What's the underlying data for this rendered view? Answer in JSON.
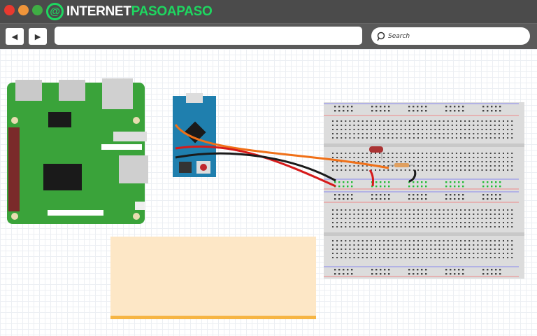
{
  "window": {
    "controls": [
      {
        "name": "close",
        "color": "#e8392f"
      },
      {
        "name": "minimize",
        "color": "#f0953a"
      },
      {
        "name": "maximize",
        "color": "#3fae44"
      }
    ]
  },
  "brand": {
    "part1": "INTERNET",
    "part2": "PASOAPASO",
    "icon": "at-sign-icon",
    "color1": "#ffffff",
    "color2": "#1ed760"
  },
  "toolbar": {
    "back": "◀",
    "forward": "▶",
    "url": "",
    "search_placeholder": "Search"
  },
  "diagram": {
    "board1": "raspberry-pi",
    "board2": "arduino-micro",
    "breadboard": "breadboard",
    "components": [
      "photoresistor",
      "resistor"
    ],
    "wire_colors": {
      "signal": "#f07018",
      "power": "#d61a1a",
      "ground": "#1a1a1a"
    }
  },
  "note": {
    "text": ""
  }
}
